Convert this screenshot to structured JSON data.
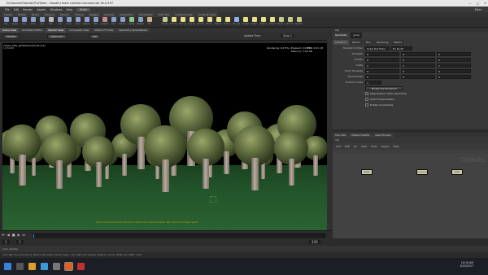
{
  "window": {
    "title": "D:/HoudiniTutorial/TheTrees - Houdini Indie Limited-Commercial 16.0.557",
    "controls": [
      "—",
      "□",
      "✕"
    ]
  },
  "menu": {
    "items": [
      "File",
      "Edit",
      "Render",
      "Assets",
      "Windows",
      "Help"
    ],
    "build": "Build",
    "mode": "Main"
  },
  "shelf_tabs": [
    "Create",
    "Modify",
    "Model",
    "Polygon",
    "Deform",
    "Texture",
    "Rigging",
    "Muscles",
    "Characters",
    "Constraints",
    "Hair Utils",
    "Guide Process",
    "Guide Brushes",
    "Terrain FX",
    "Simple FX",
    "Cloud FX",
    "Volume",
    "Lights and Cameras",
    "Collisions",
    "Particles",
    "Grains",
    "Rigid Bodies",
    "Particle Fluids",
    "Viscous Fluids",
    "Oceans",
    "Fluid Containers",
    "Populate Containers",
    "Container Tools",
    "Pyro FX",
    "FEM",
    "Wires",
    "Crowds",
    "Drive Simulation"
  ],
  "shelf_tools": [
    {
      "label": "Box",
      "color": "#8aa0c8"
    },
    {
      "label": "Sphere",
      "color": "#8aa0c8"
    },
    {
      "label": "Tube",
      "color": "#8aa0c8"
    },
    {
      "label": "Torus",
      "color": "#8aa0c8"
    },
    {
      "label": "Grid",
      "color": "#8aa0c8"
    },
    {
      "label": "Null",
      "color": "#bbbbbb"
    },
    {
      "label": "Line",
      "color": "#8aa0c8"
    },
    {
      "label": "Circle",
      "color": "#8aa0c8"
    },
    {
      "label": "Curve",
      "color": "#8aa0c8"
    },
    {
      "label": "Draw Curve",
      "color": "#8aa0c8"
    },
    {
      "label": "Path",
      "color": "#8aa0c8"
    },
    {
      "label": "Spray Paint",
      "color": "#c88a8a"
    },
    {
      "label": "Font",
      "color": "#8aa0c8"
    },
    {
      "label": "Platonic",
      "color": "#8aa0c8"
    },
    {
      "label": "L-System",
      "color": "#8ac88a"
    },
    {
      "label": "Metaball",
      "color": "#8aa0c8"
    },
    {
      "label": "File",
      "color": "#c8b48a"
    },
    {
      "label": "Camera",
      "color": "#c8c88a"
    },
    {
      "label": "Point Light",
      "color": "#e8e08a"
    },
    {
      "label": "Spot Light",
      "color": "#e8e08a"
    },
    {
      "label": "Area Light",
      "color": "#e8e08a"
    },
    {
      "label": "Geometry Light",
      "color": "#e8e08a"
    },
    {
      "label": "Volume Light",
      "color": "#e8e08a"
    },
    {
      "label": "Distant Light",
      "color": "#e8e08a"
    },
    {
      "label": "Environment Light",
      "color": "#e8e08a"
    },
    {
      "label": "Sky Light",
      "color": "#8ab4e8"
    },
    {
      "label": "GI Light",
      "color": "#e8e08a"
    },
    {
      "label": "Caustic Light",
      "color": "#e8e08a"
    },
    {
      "label": "Portal Light",
      "color": "#e8e08a"
    },
    {
      "label": "Ambient Light",
      "color": "#e8e08a"
    },
    {
      "label": "Stereo Camera",
      "color": "#c8c88a"
    },
    {
      "label": "VR Camera",
      "color": "#c8c88a"
    },
    {
      "label": "Switcher",
      "color": "#c8c88a"
    }
  ],
  "viewport": {
    "tabs": [
      "Scene View",
      "Animation Editor",
      "Render View",
      "Composite View",
      "Motion FX View",
      "Geometry Spreadsheet"
    ],
    "path": "obj",
    "renderer": "Mantra",
    "camera": "/obj/cam1",
    "update_mode": "Update Time",
    "snapshot": "Snap 1",
    "node_label": "instancefile_gltf(aTree1b(0.82,0.5)",
    "sub_label": "1125x638",
    "render_status": "Rendering (14.5%)...",
    "elapsed": "Elapsed: 0:00:14",
    "eta": "ETA: 0:01:18",
    "memory": "Memory: 1.04 GB",
    "overlay_hint": "Click to focus render point. Alt-click or shift-click to inspect renderer data. Ctrl-click to inspect point.",
    "bottom_path": "/out/mantra_ipr   Snap 1"
  },
  "params": {
    "path": "obj",
    "node_type": "Geometry",
    "node_name": "grass",
    "tabs": [
      "Transform",
      "Render",
      "Misc",
      "Rendering",
      "Mantra"
    ],
    "transform_order": "Scale Rot Trans",
    "rotate_order": "Rx Ry Rz",
    "rows": [
      {
        "label": "Translate",
        "x": "0",
        "y": "0",
        "z": "0"
      },
      {
        "label": "Rotate",
        "x": "0",
        "y": "0",
        "z": "0"
      },
      {
        "label": "Scale",
        "x": "1",
        "y": "1",
        "z": "1"
      },
      {
        "label": "Pivot Translate",
        "x": "0",
        "y": "0",
        "z": "0"
      },
      {
        "label": "Pivot Rotate",
        "x": "0",
        "y": "0",
        "z": "0"
      }
    ],
    "uniform_scale": {
      "label": "Uniform Scale",
      "value": "1"
    },
    "modify_transform": "Modify Pre-Transform",
    "checks": [
      "Keep Position When Parenting",
      "Child Compensation",
      "Enable Constraints"
    ]
  },
  "network": {
    "tabs": [
      "Tree View",
      "Material Palette",
      "Asset Browser"
    ],
    "path": "obj",
    "menu": [
      "Add",
      "Edit",
      "Go",
      "View",
      "Tools",
      "Layout",
      "Help"
    ],
    "context_label": "Objects",
    "nodes": [
      {
        "name": "grass",
        "color": "#c9c9a8"
      },
      {
        "name": "treeInstance",
        "color": "#c9c9a8"
      },
      {
        "name": "cam1",
        "color": "#c9c9a8"
      }
    ]
  },
  "timeline": {
    "frame_start": "1",
    "frame_end": "240",
    "current": "1"
  },
  "status": {
    "left": "Auto Update",
    "message": "Add LMB: focus rendering. Shift+drag: select render region. Ctrl+left-click outside image to cancel. MMB: pan. RMB: zoom."
  },
  "taskbar": {
    "time": "10:19 AM",
    "date": "6/25/2017"
  }
}
